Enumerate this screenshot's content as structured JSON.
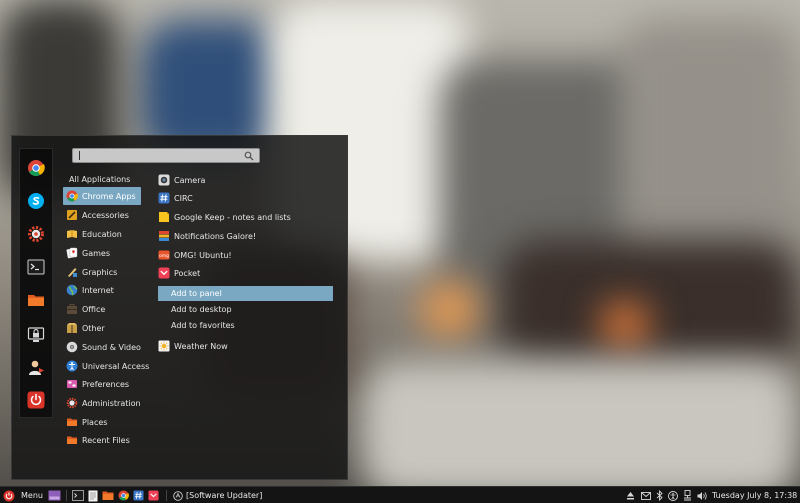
{
  "search": {
    "placeholder": ""
  },
  "favorites": [
    {
      "name": "chrome"
    },
    {
      "name": "skype"
    },
    {
      "name": "settings"
    },
    {
      "name": "terminal"
    },
    {
      "name": "files"
    },
    {
      "name": "lock-screen"
    },
    {
      "name": "logout"
    },
    {
      "name": "shutdown"
    }
  ],
  "categories": [
    {
      "label": "All Applications"
    },
    {
      "label": "Chrome Apps"
    },
    {
      "label": "Accessories"
    },
    {
      "label": "Education"
    },
    {
      "label": "Games"
    },
    {
      "label": "Graphics"
    },
    {
      "label": "Internet"
    },
    {
      "label": "Office"
    },
    {
      "label": "Other"
    },
    {
      "label": "Sound & Video"
    },
    {
      "label": "Universal Access"
    },
    {
      "label": "Preferences"
    },
    {
      "label": "Administration"
    },
    {
      "label": "Places"
    },
    {
      "label": "Recent Files"
    }
  ],
  "apps": [
    {
      "label": "Camera"
    },
    {
      "label": "CIRC"
    },
    {
      "label": "Google Keep - notes and lists"
    },
    {
      "label": "Notifications Galore!"
    },
    {
      "label": "OMG! Ubuntu!"
    },
    {
      "label": "Pocket"
    }
  ],
  "context_menu": [
    {
      "label": "Add to panel"
    },
    {
      "label": "Add to desktop"
    },
    {
      "label": "Add to favorites"
    }
  ],
  "apps_after": [
    {
      "label": "Weather Now"
    }
  ],
  "taskbar": {
    "menu_label": "Menu",
    "window_label": "[Software Updater]",
    "clock": "Tuesday July  8, 17:38"
  },
  "colors": {
    "selection": "#7aa8c2",
    "panel": "#141414"
  }
}
